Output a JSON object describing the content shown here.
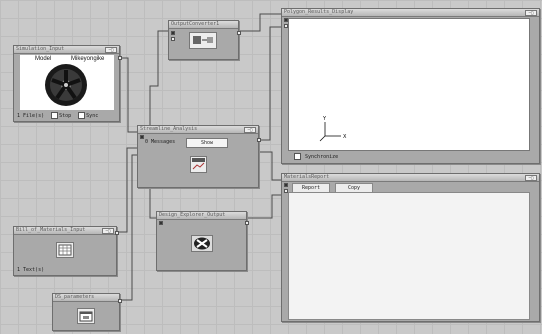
{
  "nodes": {
    "simulation_input": {
      "title": "Simulation_Input",
      "preview_left_label": "Model",
      "preview_right_label": "Mikeyongike",
      "file_count": "1 File(s)",
      "stop_label": "Stop",
      "sync_label": "Sync"
    },
    "output_converter": {
      "title": "OutputConverter1"
    },
    "streamline_analysis": {
      "title": "Streamline_Analysis",
      "messages_label": "0 Messages",
      "show_button": "Show"
    },
    "design_explorer_output": {
      "title": "Design_Explorer_Output"
    },
    "bill_of_materials_input": {
      "title": "Bill_of_Materials_Input",
      "text_count": "1 Text(s)"
    },
    "ds_parameters": {
      "title": "DS_parameters"
    },
    "polygon_results_display": {
      "title": "Polygon_Results_Display",
      "synchronize_label": "Synchronize",
      "axis_y": "Y",
      "axis_x": "X"
    },
    "materials_report": {
      "title": "MaterialsReport",
      "report_button": "Report",
      "copy_button": "Copy"
    }
  },
  "icons": {
    "wheel": "alloy-wheel-preview",
    "converter": "converter-icon",
    "chart": "chart-icon",
    "design_explorer": "design-explorer-icon",
    "table": "table-icon",
    "folder": "folder-window-icon"
  },
  "colors": {
    "canvas": "#c9c9c9",
    "node": "#a9a9a9",
    "title_bar": "#cfcfcf",
    "wire": "#4a4a4a"
  }
}
